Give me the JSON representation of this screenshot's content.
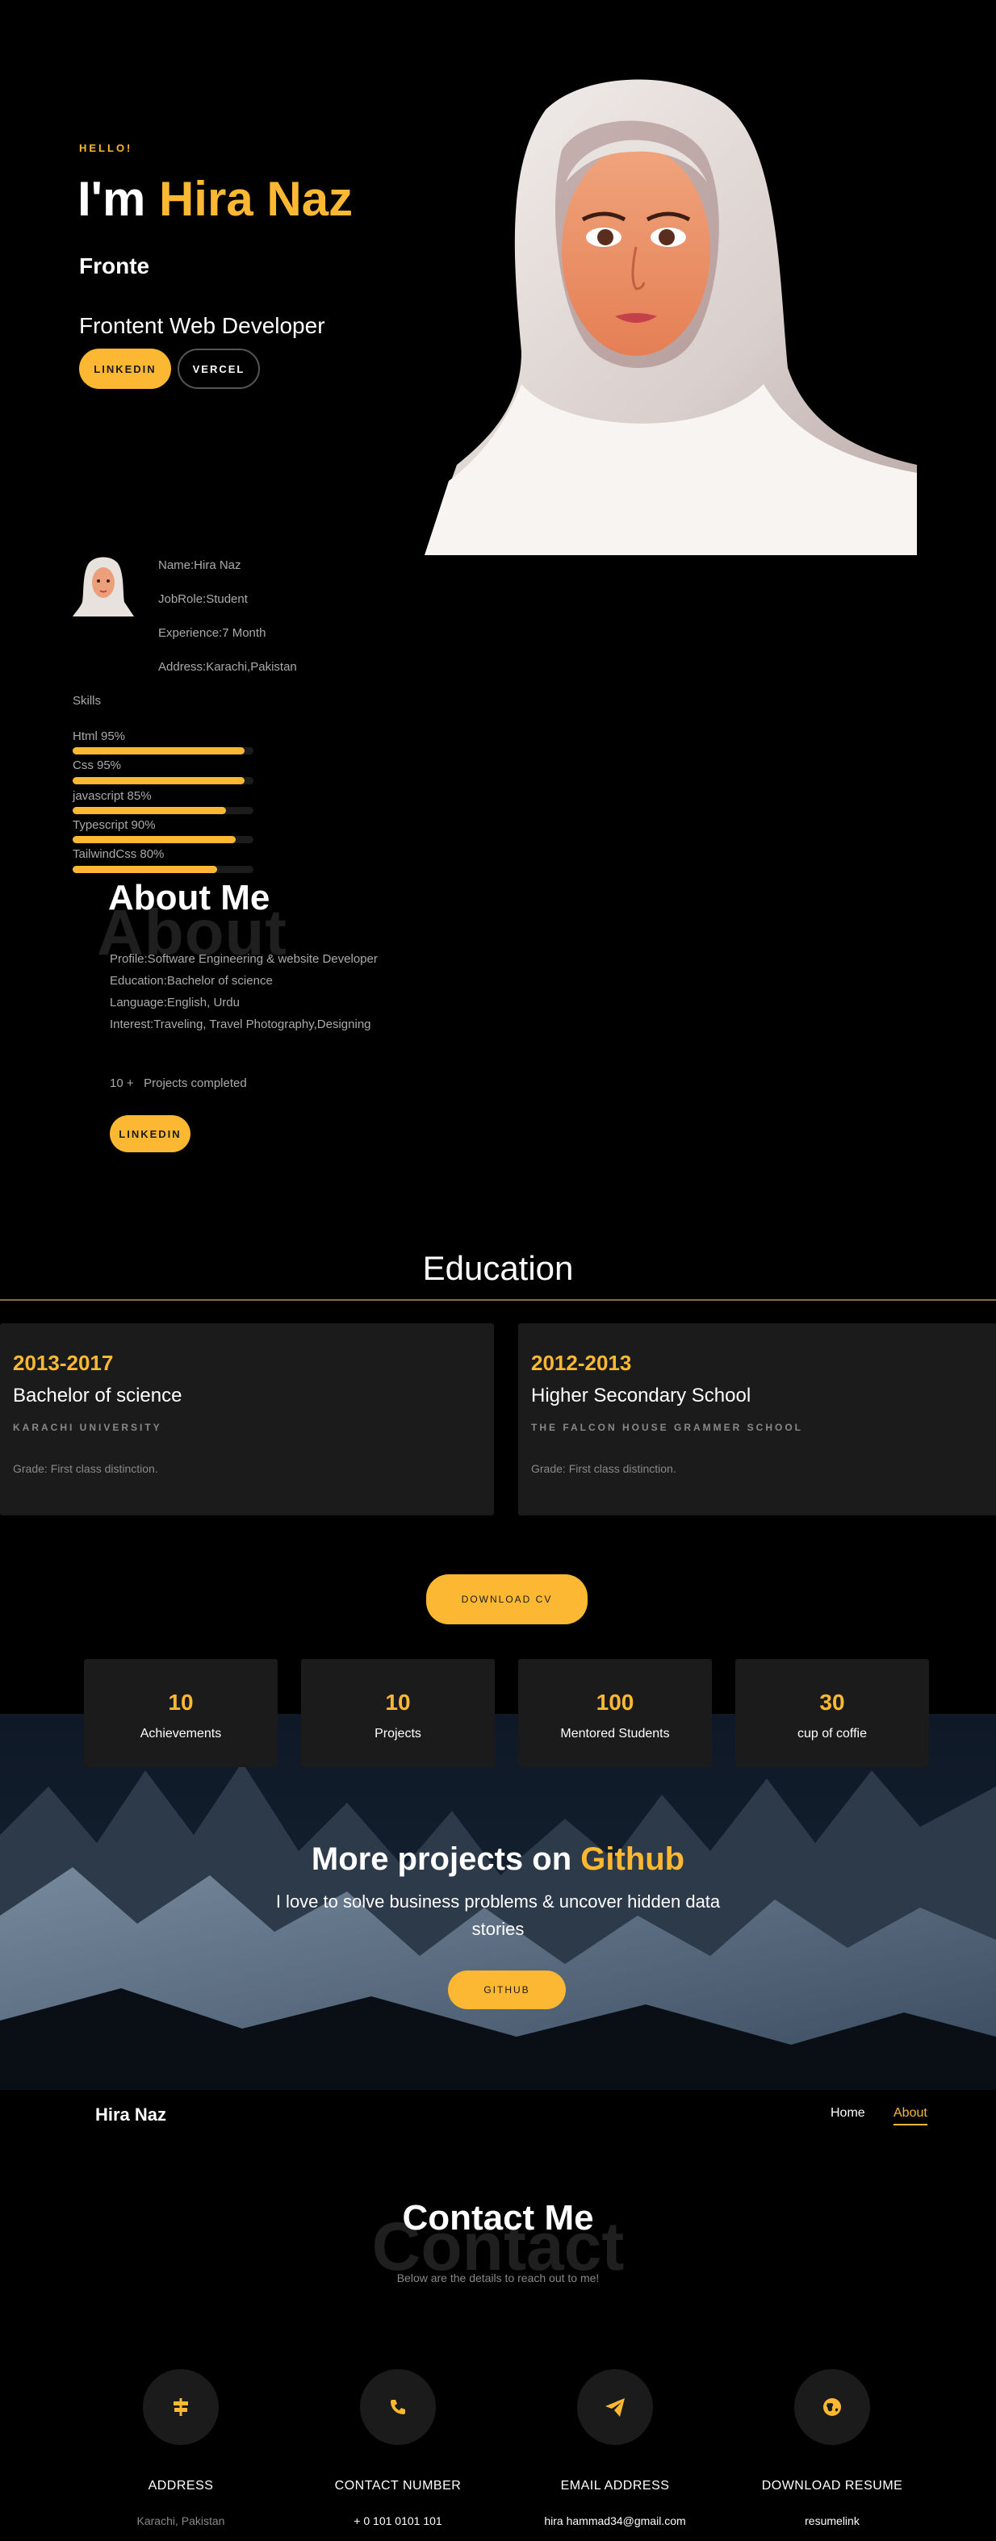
{
  "hero": {
    "hello": "HELLO!",
    "im": "I'm",
    "name": "Hira Naz",
    "typing": "Fronte",
    "role": "Frontent Web Developer",
    "btn_linkedin": "LINKEDIN",
    "btn_vercel": "VERCEL"
  },
  "profile": {
    "name": "Name:Hira Naz",
    "job": "JobRole:Student",
    "experience": "Experience:7 Month",
    "address": "Address:Karachi,Pakistan",
    "skills_title": "Skills",
    "skills": [
      {
        "label": "Html 95%",
        "percent": 95
      },
      {
        "label": "Css 95%",
        "percent": 95
      },
      {
        "label": "javascript 85%",
        "percent": 85
      },
      {
        "label": "Typescript 90%",
        "percent": 90
      },
      {
        "label": "TailwindCss 80%",
        "percent": 80
      }
    ]
  },
  "about": {
    "bg_word": "About",
    "title": "About Me",
    "profile": "Profile:Software Engineering & website Developer",
    "education": "Education:Bachelor of science",
    "language": "Language:English, Urdu",
    "interest": "Interest:Traveling, Travel Photography,Designing",
    "projects_count": "10 +",
    "projects_label": "Projects completed",
    "btn_linkedin": "LINKEDIN"
  },
  "education": {
    "title": "Education",
    "cards": [
      {
        "years": "2013-2017",
        "degree": "Bachelor of science",
        "school": "KARACHI UNIVERSITY",
        "grade": "Grade: First class distinction."
      },
      {
        "years": "2012-2013",
        "degree": "Higher Secondary School",
        "school": "THE FALCON HOUSE GRAMMER SCHOOL",
        "grade": "Grade: First class distinction."
      }
    ],
    "download_cv": "DOWNLOAD CV"
  },
  "stats": [
    {
      "num": "10",
      "label": "Achievements"
    },
    {
      "num": "10",
      "label": "Projects"
    },
    {
      "num": "100",
      "label": "Mentored Students"
    },
    {
      "num": "30",
      "label": "cup of coffie"
    }
  ],
  "github": {
    "title_pre": "More projects on",
    "title_accent": "Github",
    "subtitle": "I love to solve business problems & uncover hidden data stories",
    "button": "GITHUB"
  },
  "nav": {
    "brand": "Hira Naz",
    "home": "Home",
    "about": "About"
  },
  "contact": {
    "bg_word": "Contact",
    "title": "Contact Me",
    "subtitle": "Below are the details to reach out to me!",
    "items": [
      {
        "title": "ADDRESS",
        "value": "Karachi, Pakistan",
        "icon": "signpost-icon"
      },
      {
        "title": "CONTACT NUMBER",
        "value": "+ 0 101 0101 101",
        "icon": "phone-icon"
      },
      {
        "title": "EMAIL ADDRESS",
        "value": "hira hammad34@gmail.com",
        "icon": "paper-plane-icon"
      },
      {
        "title": "DOWNLOAD RESUME",
        "value": "resumelink",
        "icon": "globe-icon"
      }
    ]
  },
  "colors": {
    "accent": "#fdb833",
    "card": "#1b1b1b",
    "background": "#000000"
  }
}
